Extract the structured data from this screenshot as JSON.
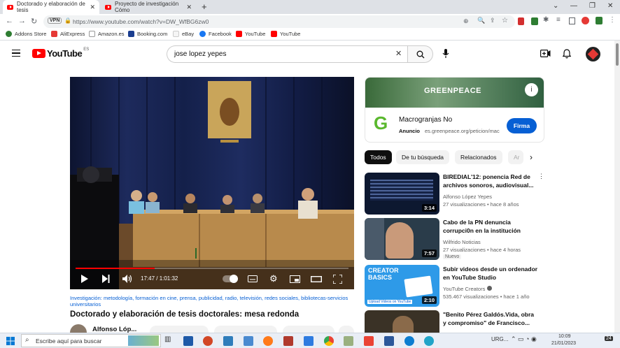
{
  "browser": {
    "tabs": [
      {
        "title": "Doctorado y elaboración de tesis"
      },
      {
        "title": "Proyecto de investigación Cómo"
      }
    ],
    "new_tab": "+",
    "url": "https://www.youtube.com/watch?v=DW_WfBG6zw0",
    "bookmarks": [
      {
        "label": "Addons Store",
        "color": "#2e7d32"
      },
      {
        "label": "AliExpress",
        "color": "#e53935"
      },
      {
        "label": "Amazon.es",
        "color": "#222222"
      },
      {
        "label": "Booking.com",
        "color": "#1a3d8f"
      },
      {
        "label": "eBay",
        "color": "#e53238"
      },
      {
        "label": "Facebook",
        "color": "#1877f2"
      },
      {
        "label": "YouTube",
        "color": "#ff0000"
      },
      {
        "label": "YouTube",
        "color": "#ff0000"
      }
    ]
  },
  "youtube": {
    "logo_text": "YouTube",
    "region": "ES",
    "search_value": "jose lopez yepes"
  },
  "player": {
    "time": "17:47 / 1:01:32",
    "progress": 0.29
  },
  "video": {
    "tags": "Investigación: metodología, formación en cine, prensa, publicidad, radio, televisión, redes sociales, bibliotecas-servicios universitarios",
    "title": "Doctorado y elaboración de tesis doctorales: mesa redonda",
    "channel": "Alfonso Lóp..."
  },
  "ad": {
    "banner": "GREENPEACE",
    "title": "Macrogranjas No",
    "badge": "Anuncio",
    "domain": "es.greenpeace.org/peticion/mac",
    "cta": "Firma"
  },
  "chips": [
    "Todos",
    "De tu búsqueda",
    "Relacionados",
    "Ar"
  ],
  "sidebar": [
    {
      "title": "BIREDIAL'12: ponencia Red de archivos sonoros, audiovisual...",
      "channel": "Alfonso López Yepes",
      "meta": "27 visualizaciones • hace 8 años",
      "duration": "3:14",
      "badge": ""
    },
    {
      "title": "Cabo de la PN denuncia corrupci0n en la institución",
      "channel": "Wilfrido Noticias",
      "meta": "27 visualizaciones • hace 4 horas",
      "duration": "7:57",
      "badge": "Nuevo"
    },
    {
      "title": "Subir videos desde un ordenador en YouTube Studio",
      "channel": "YouTube Creators",
      "meta": "535.467 visualizaciones • hace 1 año",
      "duration": "2:10",
      "badge": "",
      "thumb_title": "CREATOR BASICS",
      "thumb_sub": "Upload Videos on YouTube"
    },
    {
      "title": "\"Benito Pérez Galdós.Vida, obra y compromiso\" de Francisco...",
      "channel": "",
      "meta": "",
      "duration": "",
      "badge": ""
    }
  ],
  "taskbar": {
    "search_placeholder": "Escribe aquí para buscar",
    "lang": "URG...",
    "time": "10:09",
    "date": "21/01/2023",
    "notif": "24"
  }
}
